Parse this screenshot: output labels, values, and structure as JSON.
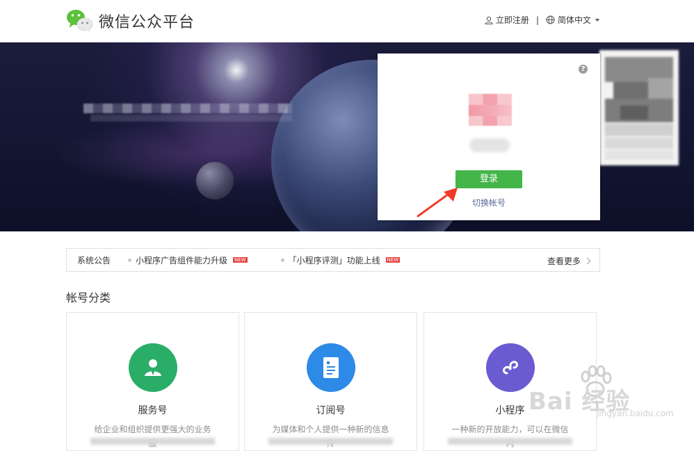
{
  "header": {
    "brand": "微信公众平台",
    "register": "立即注册",
    "separator": "|",
    "language": "简体中文"
  },
  "login": {
    "help_glyph": "?",
    "login_button": "登录",
    "switch_account": "切换帐号"
  },
  "notice": {
    "title": "系统公告",
    "items": [
      {
        "text": "小程序广告组件能力升级",
        "badge": "NEW"
      },
      {
        "text": "「小程序评测」功能上线",
        "badge": "NEW"
      }
    ],
    "more": "查看更多"
  },
  "section": {
    "title": "帐号分类"
  },
  "cards": [
    {
      "title": "服务号",
      "desc": "给企业和组织提供更强大的业务服",
      "color": "#2aae67"
    },
    {
      "title": "订阅号",
      "desc": "为媒体和个人提供一种新的信息传",
      "color": "#2d8ae6"
    },
    {
      "title": "小程序",
      "desc": "一种新的开放能力，可以在微信内",
      "color": "#6a5bd1"
    }
  ],
  "watermark": {
    "text": "Bai 经验",
    "url": "jingyan.baidu.com"
  },
  "colors": {
    "accent": "#44b549",
    "link": "#576b95"
  }
}
